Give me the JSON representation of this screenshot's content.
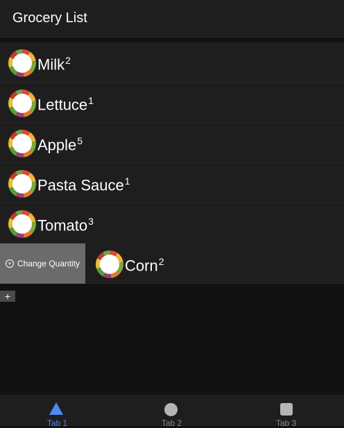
{
  "header": {
    "title": "Grocery List"
  },
  "items": [
    {
      "name": "Milk",
      "quantity": "2"
    },
    {
      "name": "Lettuce",
      "quantity": "1"
    },
    {
      "name": "Apple",
      "quantity": "5"
    },
    {
      "name": "Pasta Sauce",
      "quantity": "1"
    },
    {
      "name": "Tomato",
      "quantity": "3"
    },
    {
      "name": "Corn",
      "quantity": "2"
    }
  ],
  "swipe_option": {
    "label": "Change Quantity",
    "icon": "add-circle-icon"
  },
  "add_button": {
    "label": "+"
  },
  "tabs": [
    {
      "label": "Tab 1",
      "icon": "triangle-icon"
    },
    {
      "label": "Tab 2",
      "icon": "circle-icon"
    },
    {
      "label": "Tab 3",
      "icon": "square-icon"
    }
  ],
  "colors": {
    "active_tab": "#4a8af4",
    "background": "#121212",
    "surface": "#1e1e1e"
  }
}
